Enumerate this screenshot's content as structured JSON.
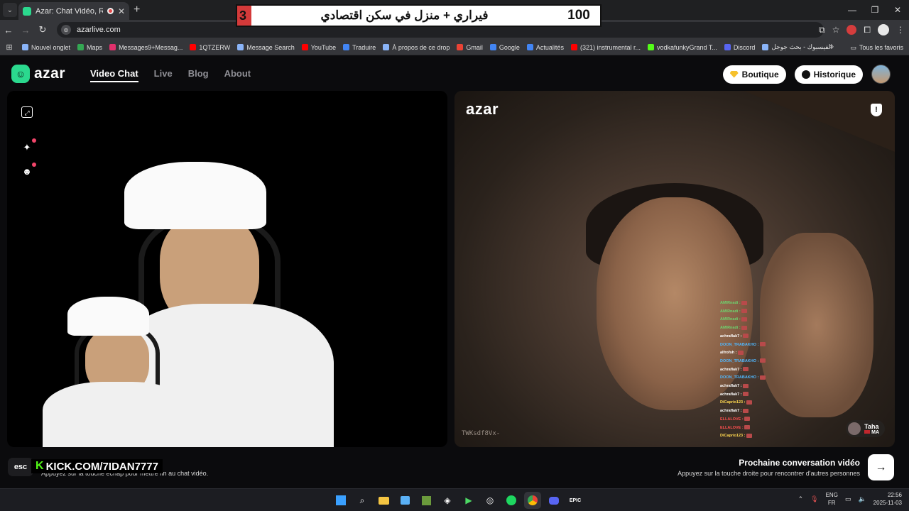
{
  "browser": {
    "tab_title": "Azar: Chat Vidéo, Rencontr...",
    "url": "azarlive.com",
    "ext_badge": "2",
    "bookmarks": [
      {
        "label": "Nouvel onglet",
        "color": "#8ab4f8"
      },
      {
        "label": "Maps",
        "color": "#34a853"
      },
      {
        "label": "Messages9+Messag...",
        "color": "#e1306c"
      },
      {
        "label": "1QTZERW",
        "color": "#ff0000"
      },
      {
        "label": "Message Search",
        "color": "#8ab4f8"
      },
      {
        "label": "YouTube",
        "color": "#ff0000"
      },
      {
        "label": "Traduire",
        "color": "#4285f4"
      },
      {
        "label": "À propos de ce drop",
        "color": "#8ab4f8"
      },
      {
        "label": "Gmail",
        "color": "#ea4335"
      },
      {
        "label": "Google",
        "color": "#4285f4"
      },
      {
        "label": "Actualités",
        "color": "#4285f4"
      },
      {
        "label": "(321) instrumental r...",
        "color": "#ff0000"
      },
      {
        "label": "vodkafunkyGrand T...",
        "color": "#53fc18"
      },
      {
        "label": "Discord",
        "color": "#5865f2"
      },
      {
        "label": "الفيسبوك - بحث جوجل",
        "color": "#8ab4f8"
      }
    ],
    "all_bookmarks": "Tous les favoris"
  },
  "stream_overlay": {
    "left_number": "3",
    "text": "فيراري + منزل في سكن اقتصادي",
    "right_number": "100"
  },
  "azar": {
    "logo": "azar",
    "nav": [
      "Video Chat",
      "Live",
      "Blog",
      "About"
    ],
    "active_nav": "Video Chat",
    "shop_button": "Boutique",
    "history_button": "Historique",
    "remote_logo": "azar",
    "remote_watermark": "TWKsdf8Vx-",
    "peer": {
      "name": "Taha",
      "country": "MA"
    },
    "esc_key": "esc",
    "esc_hint": "Appuyez sur la touche échap pour mettre fin au chat vidéo.",
    "kick_banner": "KICK.COM/7IDAN7777",
    "next_title": "Prochaine conversation vidéo",
    "next_hint": "Appuyez sur la touche droite pour rencontrer d'autres personnes"
  },
  "chat_overlay": [
    {
      "user": "AMIRnadi :",
      "color": "#6ed36e"
    },
    {
      "user": "AMIRnadi :",
      "color": "#6ed36e"
    },
    {
      "user": "AMIRnadi :",
      "color": "#6ed36e"
    },
    {
      "user": "AMIRnadi :",
      "color": "#6ed36e"
    },
    {
      "user": "achraflak7 :",
      "color": "#ffffff"
    },
    {
      "user": "DOON_TRABAKHO :",
      "color": "#4fb8ff"
    },
    {
      "user": "alfrofsh :",
      "color": "#ffffff"
    },
    {
      "user": "DOON_TRABAKHO :",
      "color": "#4fb8ff"
    },
    {
      "user": "achraflak7 :",
      "color": "#ffffff"
    },
    {
      "user": "DOON_TRABAKHO :",
      "color": "#4fb8ff"
    },
    {
      "user": "achraflak7 :",
      "color": "#ffffff"
    },
    {
      "user": "achraflak7 :",
      "color": "#ffffff"
    },
    {
      "user": "DiCaprio123 :",
      "color": "#ffd84f"
    },
    {
      "user": "achraflak7 :",
      "color": "#ffffff"
    },
    {
      "user": "ELLALOVE :",
      "color": "#ff4f4f"
    },
    {
      "user": "ELLALOVE :",
      "color": "#ff4f4f"
    },
    {
      "user": "DiCaprio123 :",
      "color": "#ffd84f"
    }
  ],
  "taskbar": {
    "lang_top": "ENG",
    "lang_bottom": "FR",
    "time": "22:56",
    "date": "2025-11-03"
  }
}
